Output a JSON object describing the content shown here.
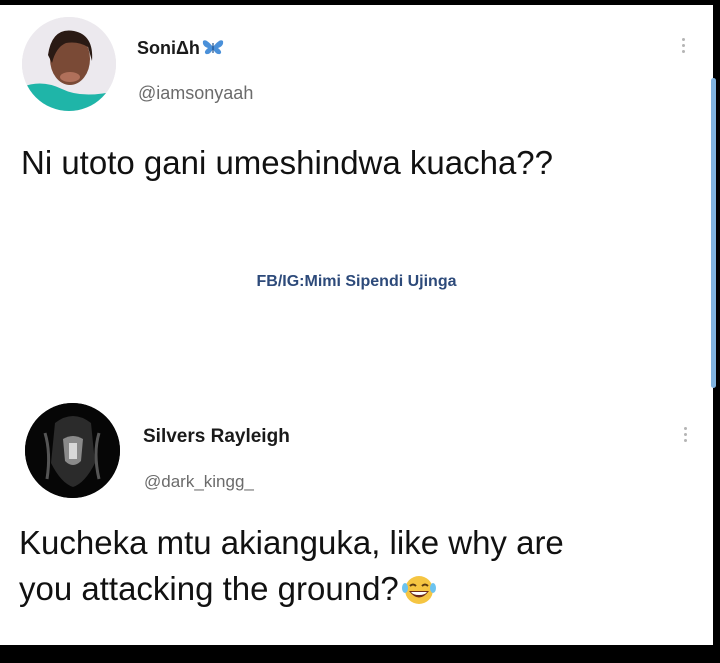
{
  "tweets": [
    {
      "display_name": "SoniΔh",
      "name_icon": "butterfly-icon",
      "handle": "@iamsonyaah",
      "text": "Ni utoto gani umeshindwa kuacha??"
    },
    {
      "display_name": "Silvers Rayleigh",
      "handle": "@dark_kingg_",
      "text_line1": "Kucheka mtu akianguka, like why are",
      "text_line2": "you attacking the ground?",
      "emoji": "laughing-face-icon"
    }
  ],
  "watermark": "FB/IG:Mimi Sipendi Ujinga",
  "colors": {
    "background_frame": "#000000",
    "card": "#ffffff",
    "watermark": "#2d4a7a",
    "scrollbar": "#7fb3e0",
    "handle": "#6b6b6b"
  }
}
